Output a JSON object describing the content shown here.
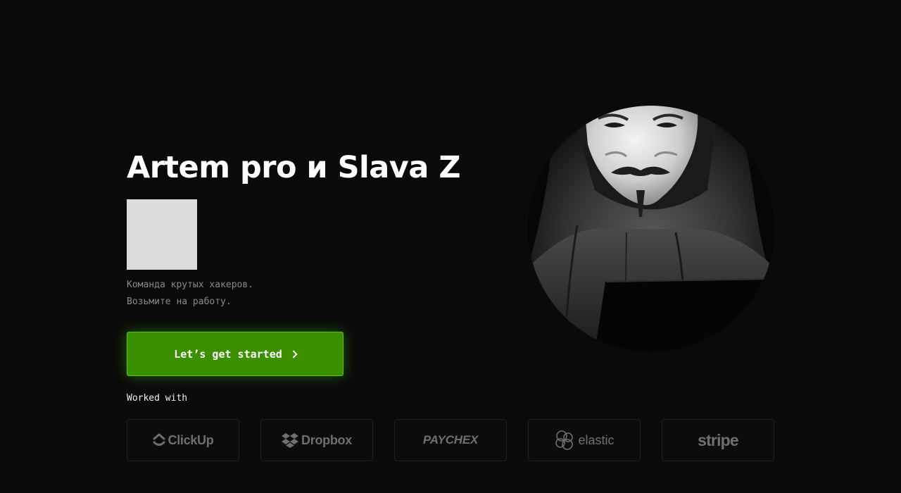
{
  "hero": {
    "title": "Artem pro и Slava Z",
    "tagline_line1": "Команда крутых хакеров.",
    "tagline_line2": "Возьмите на работу.",
    "cta_label": "Let’s get started"
  },
  "worked_with": {
    "label": "Worked with",
    "logos": [
      {
        "name": "ClickUp",
        "icon": "clickup-icon"
      },
      {
        "name": "Dropbox",
        "icon": "dropbox-icon"
      },
      {
        "name": "PAYCHEX",
        "icon": ""
      },
      {
        "name": "elastic",
        "icon": "elastic-icon"
      },
      {
        "name": "stripe",
        "icon": ""
      }
    ]
  },
  "colors": {
    "background": "#0a0a0a",
    "accent_green": "#3b8f00",
    "logo_gray": "#6f6f6f"
  }
}
